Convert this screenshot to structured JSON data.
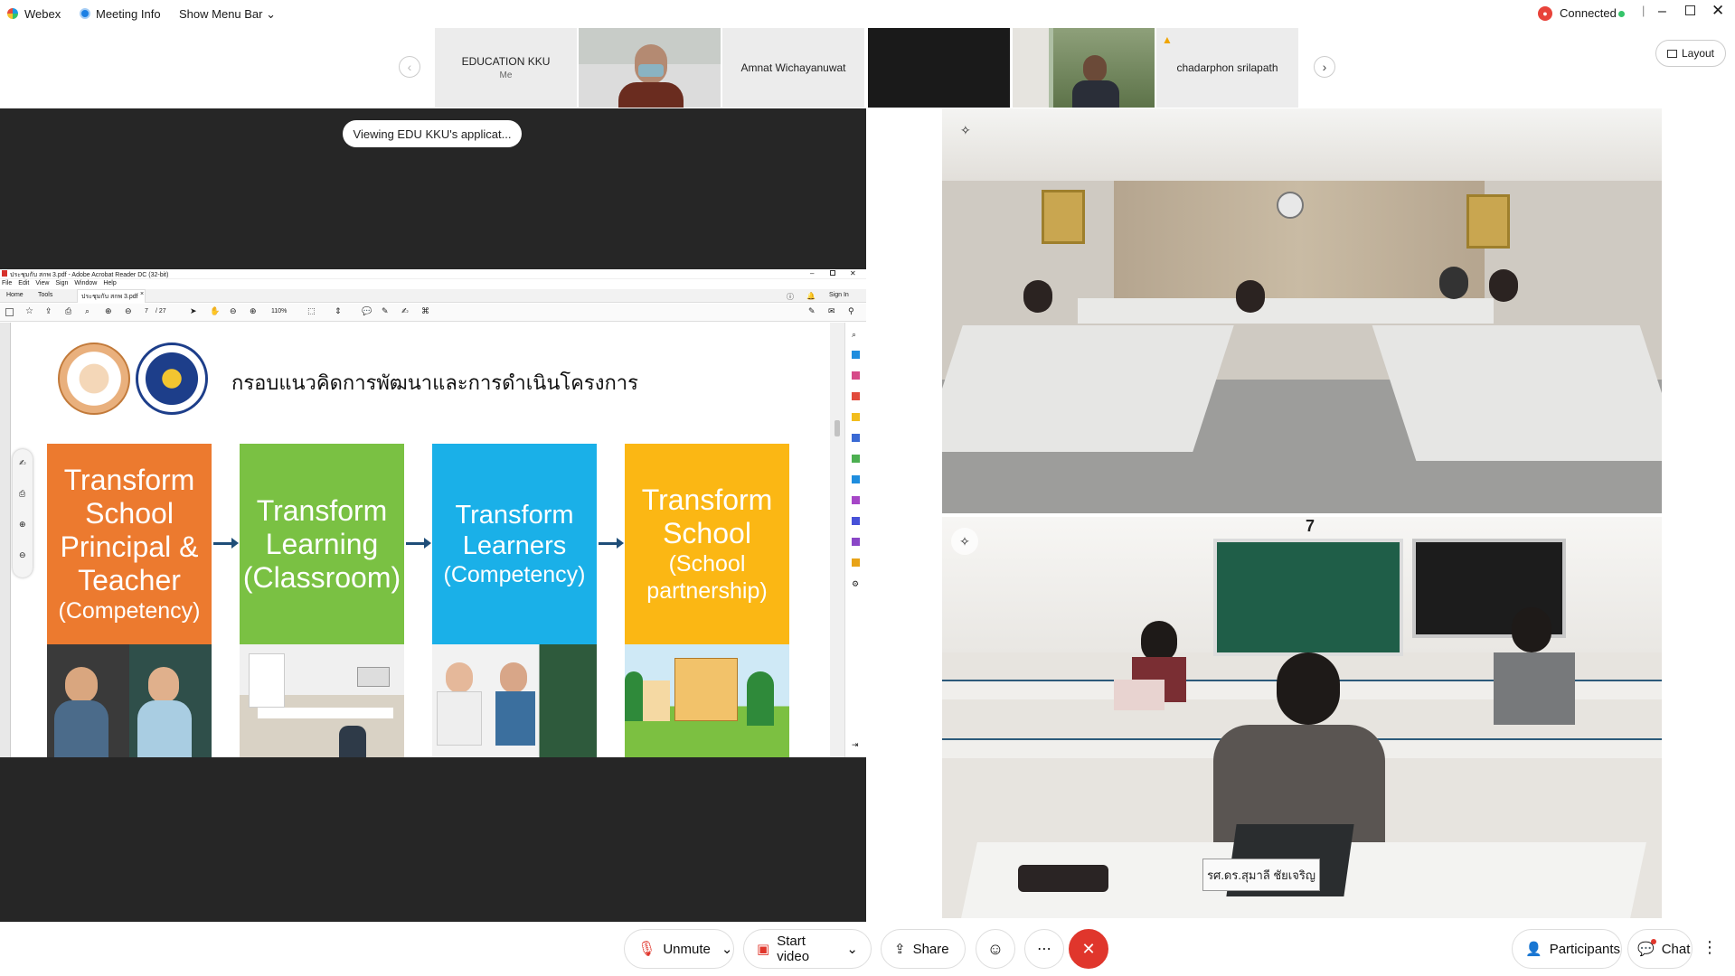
{
  "topbar": {
    "app_name": "Webex",
    "meeting_info": "Meeting Info",
    "show_menu_bar": "Show Menu Bar",
    "connection_status": "Connected"
  },
  "participants_strip": {
    "tiles": [
      {
        "name": "EDUCATION KKU",
        "subtitle": "Me"
      },
      {
        "name": "Amnat Wichayanuwat"
      },
      {
        "name": "chadarphon srilapath"
      }
    ],
    "layout_label": "Layout"
  },
  "share": {
    "toast": "Viewing EDU KKU's applicat...",
    "acrobat": {
      "window_title": "ประชุมกับ สกพ 3.pdf - Adobe Acrobat Reader DC (32-bit)",
      "menu": [
        "File",
        "Edit",
        "View",
        "Sign",
        "Window",
        "Help"
      ],
      "tabs": [
        "Home",
        "Tools"
      ],
      "doc_tab": "ประชุมกับ สกพ 3.pdf",
      "sign_in": "Sign In",
      "page_current": "7",
      "page_total": "/ 27",
      "zoom": "110%"
    },
    "slide": {
      "title": "กรอบแนวคิดการพัฒนาและการดำเนินโครงการ",
      "cards": [
        {
          "lines": "Transform School Principal & Teacher",
          "sub": "(Competency)",
          "color": "#ec7a2f"
        },
        {
          "lines": "Transform Learning (Classroom)",
          "sub": "",
          "color": "#7ac143"
        },
        {
          "lines": "Transform Learners",
          "sub": "(Competency)",
          "color": "#1ab0e8"
        },
        {
          "lines": "Transform School",
          "sub": "(School partnership)",
          "color": "#fbb714"
        }
      ]
    }
  },
  "video_panes": {
    "bottom_room_number": "7",
    "nameplate": "รศ.ดร.สุมาลี ชัยเจริญ"
  },
  "controls": {
    "unmute": "Unmute",
    "start_video": "Start video",
    "share": "Share",
    "participants": "Participants",
    "chat": "Chat"
  },
  "colors": {
    "end_call": "#e0362c",
    "accent_blue": "#1f4e79",
    "dark_bg": "#262626"
  }
}
